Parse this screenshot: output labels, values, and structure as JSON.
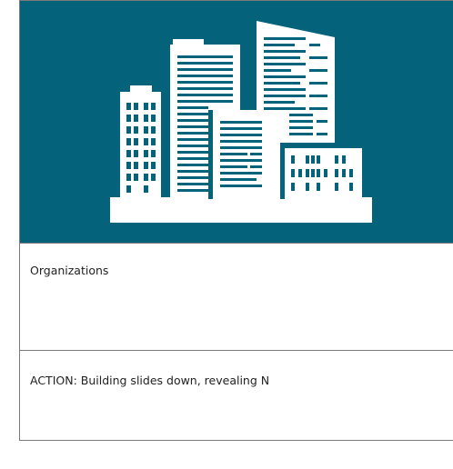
{
  "illustration": {
    "icon": "buildings-icon",
    "background_color": "#04627a",
    "icon_color": "#ffffff"
  },
  "panels": [
    {
      "label": "Organizations"
    },
    {
      "label": "ACTION: Building slides down, revealing N"
    }
  ]
}
